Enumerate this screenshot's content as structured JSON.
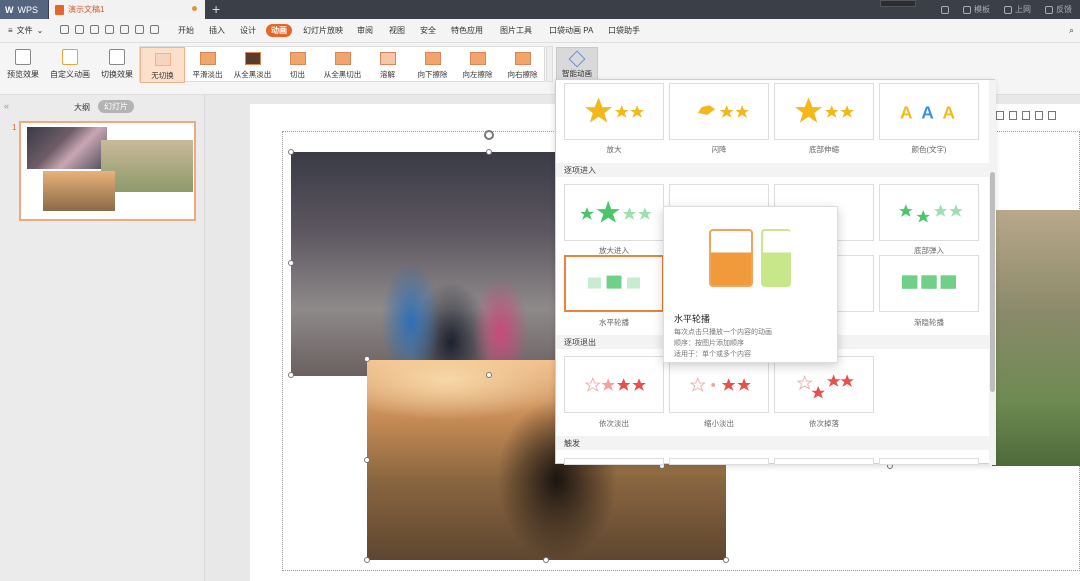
{
  "titlebar": {
    "wps_label": "WPS",
    "doc_tab": "演示文稿1",
    "right_items": [
      "模板",
      "上网",
      "反馈"
    ]
  },
  "menubar": {
    "file": "文件",
    "tabs": [
      "开始",
      "插入",
      "设计",
      "动画",
      "幻灯片放映",
      "审阅",
      "视图",
      "安全",
      "特色应用",
      "图片工具",
      "口袋动画 PA",
      "口袋助手"
    ],
    "active_tab": "动画"
  },
  "ribbon": {
    "preview": "预览效果",
    "custom": "自定义动画",
    "transition": "切换效果",
    "gallery": [
      "无切换",
      "平滑淡出",
      "从全黑淡出",
      "切出",
      "从全黑切出",
      "溶解",
      "向下擦除",
      "向左擦除",
      "向右擦除"
    ],
    "smart": "智能动画"
  },
  "sidebar": {
    "tabs": [
      "大纲",
      "幻灯片"
    ],
    "slide_number": "1"
  },
  "pane": {
    "row1": [
      "放大",
      "闪降",
      "底部伸缩",
      "颜色(文字)"
    ],
    "sections": [
      "逐项进入",
      "逐项退出",
      "触发"
    ],
    "row2": [
      "放大进入",
      "",
      "",
      "底部弹入"
    ],
    "row3": [
      "水平轮播",
      "",
      "",
      "渐隐轮播"
    ],
    "row4": [
      "依次淡出",
      "缩小淡出",
      "依次掉落"
    ]
  },
  "tooltip": {
    "title": "水平轮播",
    "lines": [
      "每次点击只播放一个内容的动画",
      "顺序：按图片添加顺序",
      "适用于：单个或多个内容"
    ]
  },
  "colors": {
    "accent": "#e8652a",
    "gold": "#f5b81c",
    "green": "#4cc46a",
    "red": "#e8504a",
    "blue": "#3a8ee6"
  }
}
